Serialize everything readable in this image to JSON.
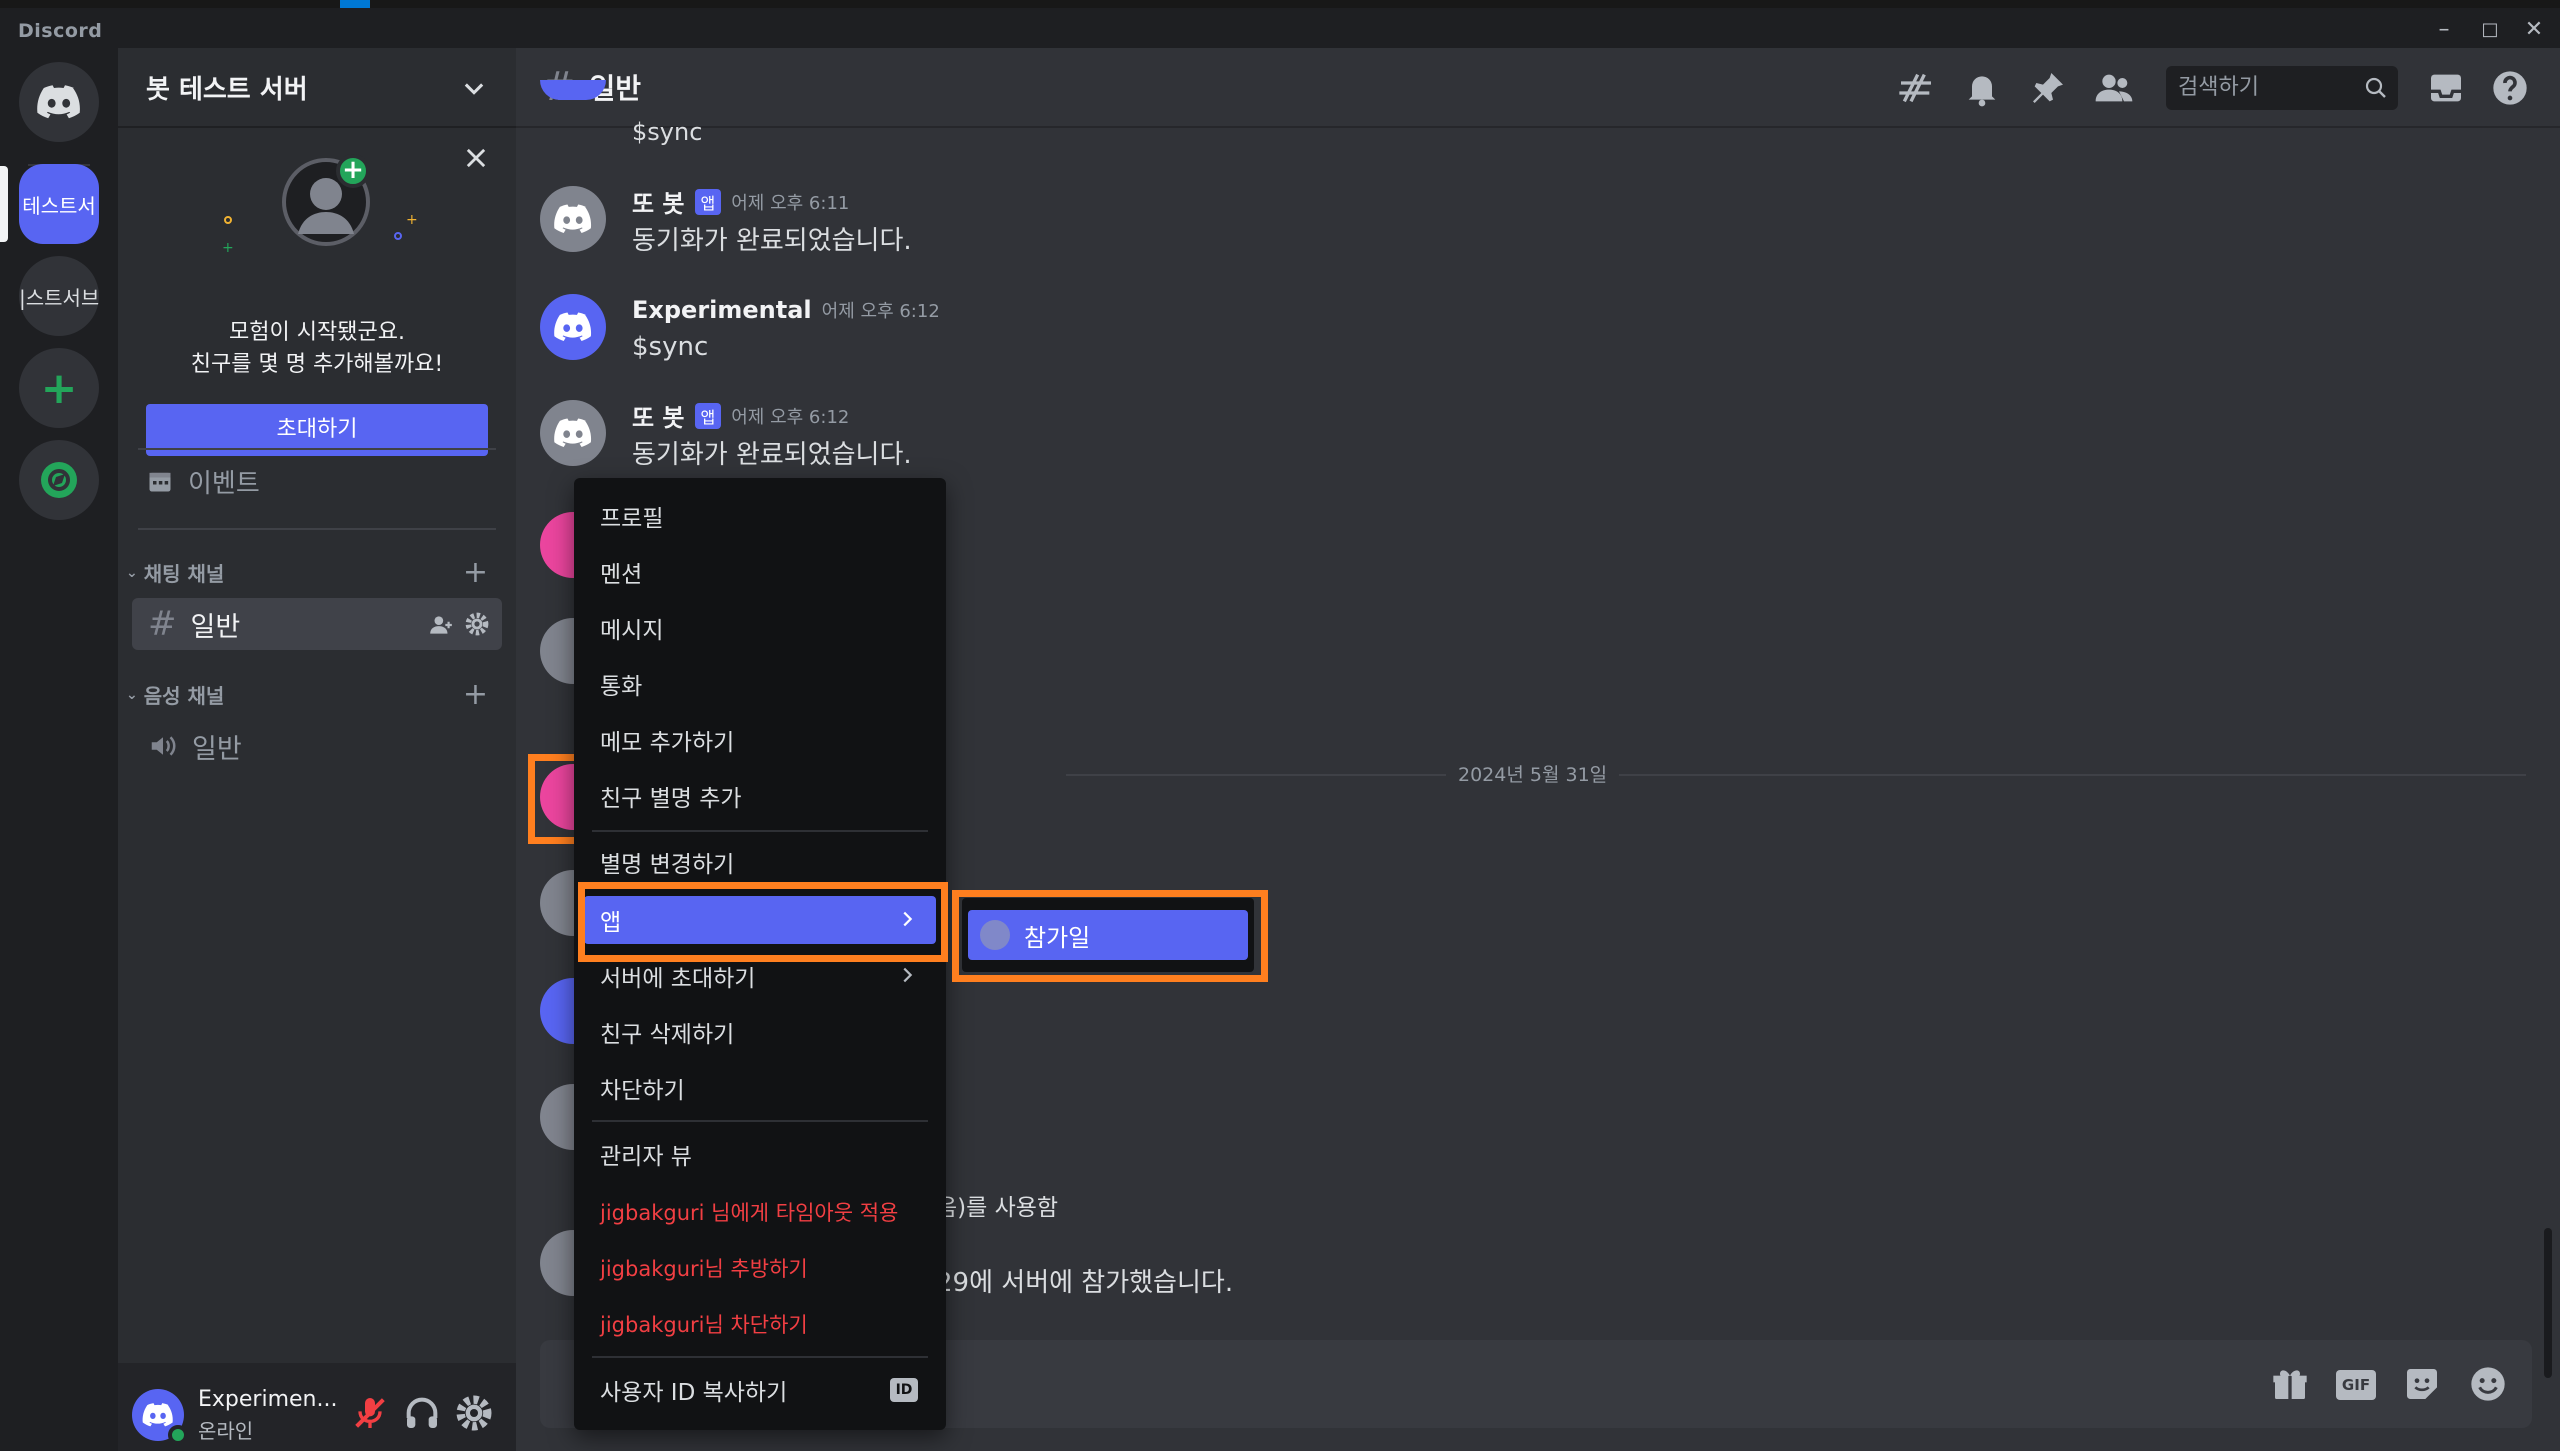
{
  "window": {
    "app_name": "Discord"
  },
  "guilds": [
    {
      "label": "테스트서"
    },
    {
      "label": "|스트서브"
    }
  ],
  "sidebar": {
    "server_name": "봇 테스트 서버",
    "promo_line1": "모험이 시작됐군요.",
    "promo_line2": "친구를 몇 명 추가해볼까요!",
    "invite_label": "초대하기",
    "events_label": "이벤트",
    "text_category": "채팅 채널",
    "text_channel": "일반",
    "voice_category": "음성 채널",
    "voice_channel": "일반"
  },
  "user_panel": {
    "name": "Experimen...",
    "status": "온라인"
  },
  "channel": {
    "name": "일반",
    "search_placeholder": "검색하기"
  },
  "messages": [
    {
      "text": "$sync"
    },
    {
      "author": "또 봇",
      "badge": "앱",
      "time": "어제 오후 6:11",
      "text": "동기화가 완료되었습니다."
    },
    {
      "author": "Experimental",
      "time": "어제 오후 6:12",
      "text": "$sync"
    },
    {
      "author": "또 봇",
      "badge": "앱",
      "time": "어제 오후 6:12",
      "text": "동기화가 완료되었습니다."
    }
  ],
  "date_divider": "2024년 5월 31일",
  "partial_texts": {
    "line1": "음)를 사용함",
    "line2": "29에 서버에 참가했습니다."
  },
  "context_menu": {
    "items": [
      {
        "label": "프로필"
      },
      {
        "label": "멘션"
      },
      {
        "label": "메시지"
      },
      {
        "label": "통화"
      },
      {
        "label": "메모 추가하기"
      },
      {
        "label": "친구 별명 추가"
      },
      {
        "label": "별명 변경하기"
      },
      {
        "label": "앱"
      },
      {
        "label": "서버에 초대하기"
      },
      {
        "label": "친구 삭제하기"
      },
      {
        "label": "차단하기"
      },
      {
        "label": "관리자 뷰"
      },
      {
        "label": "jigbakguri 님에게 타임아웃 적용"
      },
      {
        "label": "jigbakguri님 추방하기"
      },
      {
        "label": "jigbakguri님 차단하기"
      },
      {
        "label": "사용자 ID 복사하기"
      }
    ],
    "id_badge": "ID"
  },
  "submenu": {
    "item_label": "참가일"
  },
  "colors": {
    "accent": "#5865f2",
    "danger": "#f23f43",
    "online": "#23a55a",
    "highlight": "#ff7f1f"
  }
}
